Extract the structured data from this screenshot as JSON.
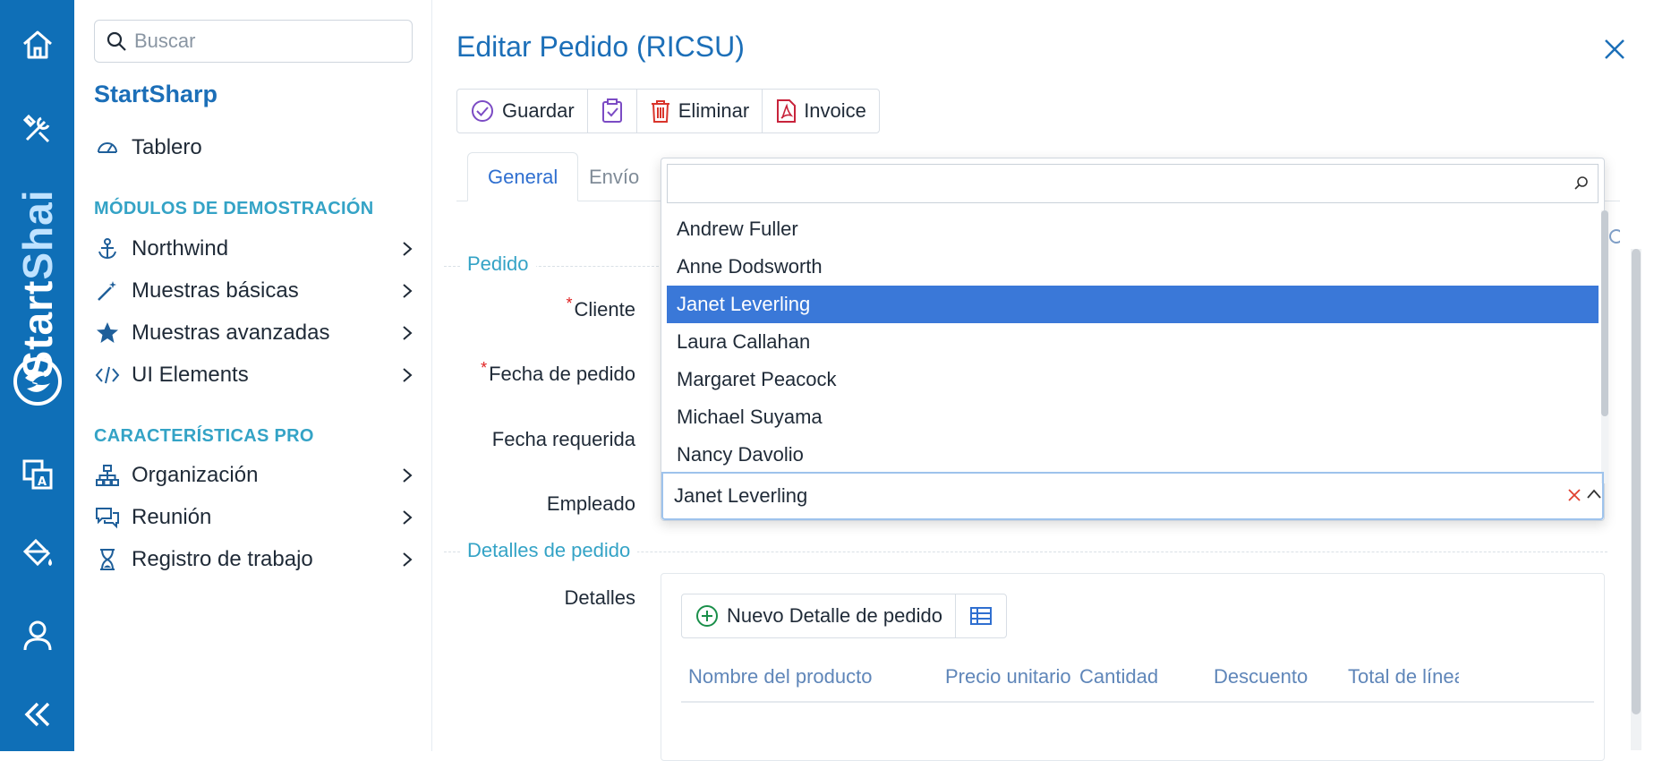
{
  "sidebar": {
    "search_placeholder": "Buscar",
    "app_title": "StartSharp",
    "dashboard_label": "Tablero",
    "section_demo": "MÓDULOS DE DEMOSTRACIÓN",
    "demo_items": [
      "Northwind",
      "Muestras básicas",
      "Muestras avanzadas",
      "UI Elements"
    ],
    "section_pro": "CARACTERÍSTICAS PRO",
    "pro_items": [
      "Organización",
      "Reunión",
      "Registro de trabajo"
    ]
  },
  "rail": {
    "brand_a": "Start",
    "brand_b": "Shai"
  },
  "dialog": {
    "title": "Editar Pedido (RICSU)",
    "toolbar": {
      "save": "Guardar",
      "delete": "Eliminar",
      "invoice": "Invoice"
    },
    "tabs": [
      "General",
      "Envío"
    ],
    "legend_order": "Pedido",
    "labels": {
      "customer": "Cliente",
      "order_date": "Fecha de pedido",
      "required_date": "Fecha requerida",
      "employee": "Empleado",
      "details": "Detalles"
    },
    "legend_details": "Detalles de pedido",
    "employee_value": "Janet Leverling",
    "dropdown_options": [
      "Andrew Fuller",
      "Anne Dodsworth",
      "Janet Leverling",
      "Laura Callahan",
      "Margaret Peacock",
      "Michael Suyama",
      "Nancy Davolio"
    ],
    "selected_option": "Janet Leverling",
    "details_new_button": "Nuevo Detalle de pedido",
    "grid_columns": [
      "Nombre del producto",
      "Precio unitario",
      "Cantidad",
      "Descuento",
      "Total de línea"
    ]
  },
  "colors": {
    "rail": "#0f6fb7",
    "accent": "#1c6fb8",
    "section": "#34a3c6",
    "selection": "#3a78d8",
    "required": "#e02020"
  }
}
